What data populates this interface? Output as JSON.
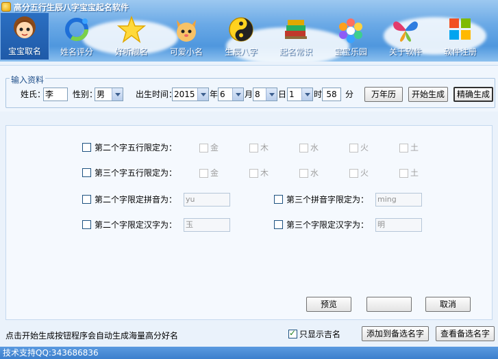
{
  "window": {
    "title": "高分五行生辰八字宝宝起名软件"
  },
  "toolbar": {
    "items": [
      {
        "label": "宝宝取名",
        "icon": "baby-face-icon"
      },
      {
        "label": "姓名评分",
        "icon": "ring-score-icon"
      },
      {
        "label": "好听靓名",
        "icon": "star-icon"
      },
      {
        "label": "可爱小名",
        "icon": "kitten-icon"
      },
      {
        "label": "生辰八字",
        "icon": "yin-yang-icon"
      },
      {
        "label": "起名常识",
        "icon": "books-icon"
      },
      {
        "label": "宝宝乐园",
        "icon": "hexagon-cluster-icon"
      },
      {
        "label": "关于软件",
        "icon": "butterfly-icon"
      },
      {
        "label": "软件注册",
        "icon": "windows-logo-icon"
      }
    ]
  },
  "input": {
    "group_title": "输入资料",
    "surname_label": "姓氏：",
    "surname_value": "李",
    "gender_label": "性别：",
    "gender_value": "男",
    "birth_label": "出生时间：",
    "year_value": "2015",
    "year_unit": "年",
    "month_value": "6",
    "month_unit": "月",
    "day_value": "8",
    "day_unit": "日",
    "hour_value": "1",
    "hour_unit": "时",
    "minute_value": "58",
    "minute_unit": "分",
    "calendar_button": "万年历",
    "start_button": "开始生成",
    "precise_button": "精确生成"
  },
  "options": {
    "second_wuxing_label": "第二个字五行限定为：",
    "third_wuxing_label": "第三个字五行限定为：",
    "elements": [
      "金",
      "木",
      "水",
      "火",
      "土"
    ],
    "second_pinyin_label": "第二个字限定拼音为：",
    "second_pinyin_value": "yu",
    "third_pinyin_label": "第三个拼音字限定为：",
    "third_pinyin_value": "ming",
    "second_hanzi_label": "第二个字限定汉字为：",
    "second_hanzi_value": "玉",
    "third_hanzi_label": "第三个字限定汉字为：",
    "third_hanzi_value": "明"
  },
  "actions": {
    "btn1": "预览",
    "btn2": "",
    "cancel": "取消"
  },
  "bottom": {
    "hint": "点击开始生成按钮程序会自动生成海量高分好名",
    "show_good_label": "只显示吉名",
    "add_button": "添加到备选名字",
    "view_button": "查看备选名字"
  },
  "status": {
    "text": "技术支持QQ:343686836"
  },
  "colors": {
    "accent": "#2b6fc2",
    "sky": "#6aa9e6",
    "status_bar": "#3c7fcc"
  }
}
